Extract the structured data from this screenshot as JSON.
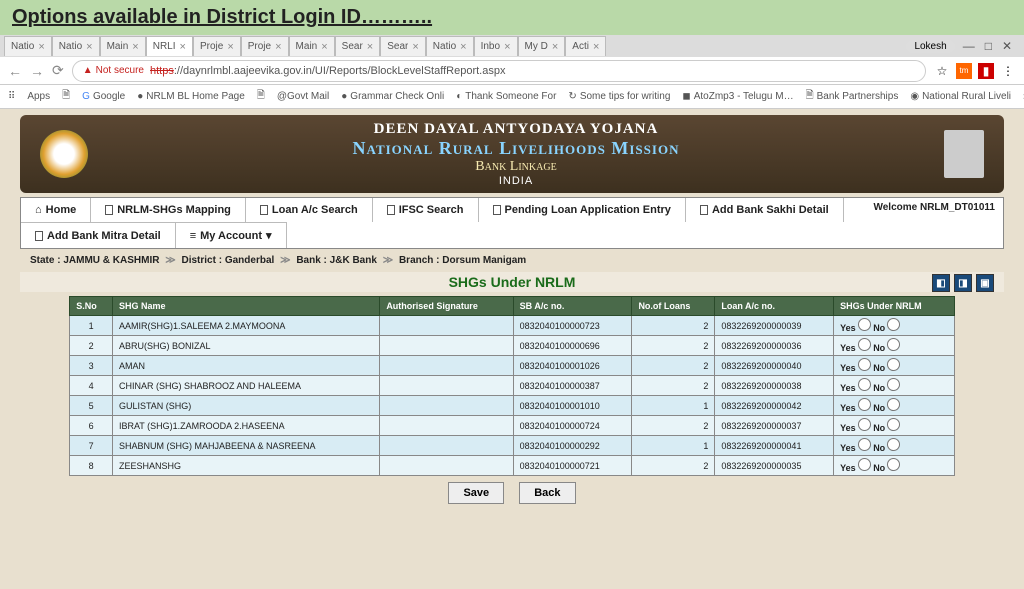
{
  "slide_title": "Options available in District Login ID………..",
  "tabs": [
    {
      "label": "Natio",
      "active": false
    },
    {
      "label": "Natio",
      "active": false
    },
    {
      "label": "Main",
      "active": false
    },
    {
      "label": "NRLI",
      "active": true
    },
    {
      "label": "Proje",
      "active": false
    },
    {
      "label": "Proje",
      "active": false
    },
    {
      "label": "Main",
      "active": false
    },
    {
      "label": "Sear",
      "active": false
    },
    {
      "label": "Sear",
      "active": false
    },
    {
      "label": "Natio",
      "active": false
    },
    {
      "label": "Inbo",
      "active": false
    },
    {
      "label": "My D",
      "active": false
    },
    {
      "label": "Acti",
      "active": false
    }
  ],
  "user_chip": "Lokesh",
  "address": {
    "not_secure": "Not secure",
    "https_striked": "https",
    "url_rest": "://daynrlmbl.aajeevika.gov.in/UI/Reports/BlockLevelStaffReport.aspx"
  },
  "bookmarks": [
    "Apps",
    "",
    "Google",
    "NRLM BL Home Page",
    "",
    "@Govt Mail",
    "Grammar Check Onli",
    "Thank Someone For",
    "Some tips for writing",
    "AtoZmp3 - Telugu M…",
    "Bank Partnerships",
    "National Rural Liveli"
  ],
  "header": {
    "line1": "DEEN DAYAL ANTYODAYA YOJANA",
    "line2": "National Rural Livelihoods Mission",
    "line3": "Bank Linkage",
    "line4": "INDIA"
  },
  "nav": {
    "home": "Home",
    "shg_map": "NRLM-SHGs Mapping",
    "loan_search": "Loan A/c Search",
    "ifsc": "IFSC Search",
    "pending": "Pending Loan Application Entry",
    "sakhi": "Add Bank Sakhi Detail",
    "mitra": "Add Bank Mitra Detail",
    "account": "My Account"
  },
  "welcome": "Welcome NRLM_DT01011",
  "breadcrumb": {
    "state_lbl": "State :",
    "state": "JAMMU & KASHMIR",
    "dist_lbl": "District :",
    "dist": "Ganderbal",
    "bank_lbl": "Bank :",
    "bank": "J&K Bank",
    "branch_lbl": "Branch :",
    "branch": "Dorsum Manigam"
  },
  "section_title": "SHGs Under NRLM",
  "table": {
    "headers": [
      "S.No",
      "SHG Name",
      "Authorised Signature",
      "SB A/c no.",
      "No.of Loans",
      "Loan A/c no.",
      "SHGs Under NRLM"
    ],
    "yes": "Yes",
    "no": "No",
    "rows": [
      {
        "sno": "1",
        "name": "AAMIR(SHG)1.SALEEMA 2.MAYMOONA",
        "sb": "0832040100000723",
        "loans": "2",
        "loan_ac": "0832269200000039"
      },
      {
        "sno": "2",
        "name": "ABRU(SHG) BONIZAL",
        "sb": "0832040100000696",
        "loans": "2",
        "loan_ac": "0832269200000036"
      },
      {
        "sno": "3",
        "name": "AMAN",
        "sb": "0832040100001026",
        "loans": "2",
        "loan_ac": "0832269200000040"
      },
      {
        "sno": "4",
        "name": "CHINAR (SHG) SHABROOZ AND HALEEMA",
        "sb": "0832040100000387",
        "loans": "2",
        "loan_ac": "0832269200000038"
      },
      {
        "sno": "5",
        "name": "GULISTAN (SHG)",
        "sb": "0832040100001010",
        "loans": "1",
        "loan_ac": "0832269200000042"
      },
      {
        "sno": "6",
        "name": "IBRAT (SHG)1.ZAMROODA 2.HASEENA",
        "sb": "0832040100000724",
        "loans": "2",
        "loan_ac": "0832269200000037"
      },
      {
        "sno": "7",
        "name": "SHABNUM (SHG) MAHJABEENA & NASREENA",
        "sb": "0832040100000292",
        "loans": "1",
        "loan_ac": "0832269200000041"
      },
      {
        "sno": "8",
        "name": "ZEESHANSHG",
        "sb": "0832040100000721",
        "loans": "2",
        "loan_ac": "0832269200000035"
      }
    ]
  },
  "buttons": {
    "save": "Save",
    "back": "Back"
  }
}
